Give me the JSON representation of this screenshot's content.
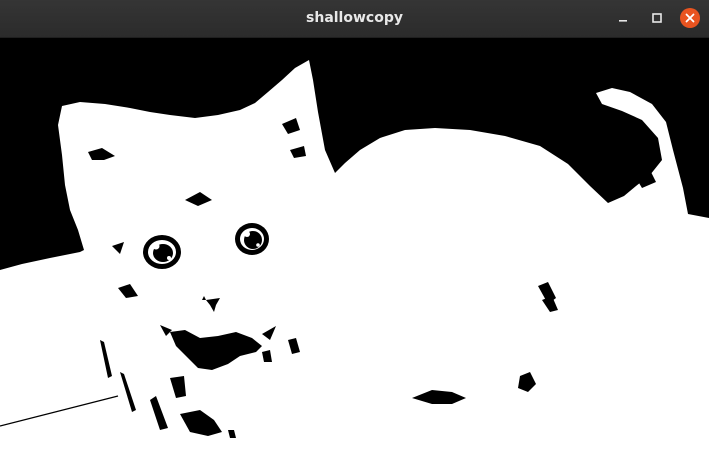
{
  "window": {
    "title": "shallowcopy",
    "controls": {
      "minimize_icon": "minimize-icon",
      "maximize_icon": "maximize-icon",
      "close_icon": "close-icon",
      "close_color": "#e95420"
    }
  },
  "image": {
    "subject_icon": "kitten-image",
    "style": "black-and-white threshold",
    "colors": {
      "foreground": "#ffffff",
      "background": "#000000"
    }
  }
}
